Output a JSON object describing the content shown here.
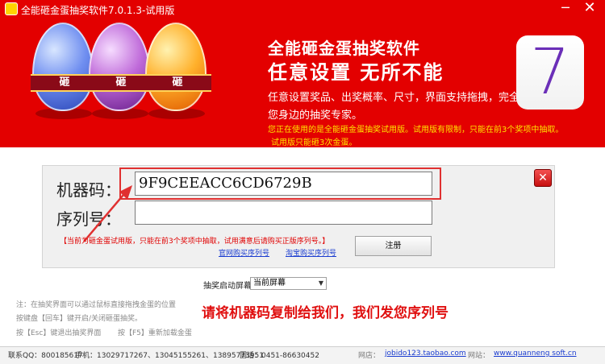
{
  "window": {
    "title": "全能砸金蛋抽奖软件7.0.1.3-试用版",
    "minimize_glyph": "─",
    "close_glyph": "✕"
  },
  "banner": {
    "egg_label": "砸",
    "headline": "全能砸金蛋抽奖软件",
    "slogan": "任意设置  无所不能",
    "description": "任意设置奖品、出奖概率、尺寸，界面支持拖拽，完全自定义。",
    "tagline": "您身边的抽奖专家。",
    "notice_line1": "您正在使用的是全能砸金蛋抽奖试用版。试用版有限制，只能在前3个奖项中抽取。",
    "notice_line2": "试用版只能砸3次金蛋。",
    "version_badge": "7",
    "colors": {
      "banner_red": "#e30000",
      "notice_yellow": "#ffe000"
    }
  },
  "registration": {
    "machine_code_label": "机器码：",
    "machine_code_value": "9F9CEEACC6CD6729B",
    "serial_label": "序列号：",
    "serial_value": "",
    "close_glyph": "✕",
    "trial_note": "【当前为砸金蛋试用版，只能在前3个奖项中抽取，试用满意后请购买正版序列号。】",
    "register_button": "注册",
    "link_official": "官网购买序列号",
    "link_taobao": "淘宝购买序列号"
  },
  "screen": {
    "label": "抽奖启动屏幕",
    "selected": "当前屏幕",
    "arrow_glyph": "▼"
  },
  "tips": {
    "tip1": "注：在抽奖界面可以通过鼠标直接拖拽金蛋的位置",
    "tip2": "按键盘【回车】键开启/关闭砸蛋抽奖。",
    "tip3": "按【Esc】键退出抽奖界面",
    "tip4": "按【F5】重新加载金蛋"
  },
  "message": "请将机器码复制给我们，我们发您序列号",
  "statusbar": {
    "qq": "联系QQ：800185617",
    "phone": "手机：13029717267、13045155261、13895773951",
    "tel": "固话：0451-86630452",
    "shop_label": "网店：",
    "shop_url": "jobido123.taobao.com",
    "site_label": "网站：",
    "site_url": "www.quanneng soft.cn"
  }
}
